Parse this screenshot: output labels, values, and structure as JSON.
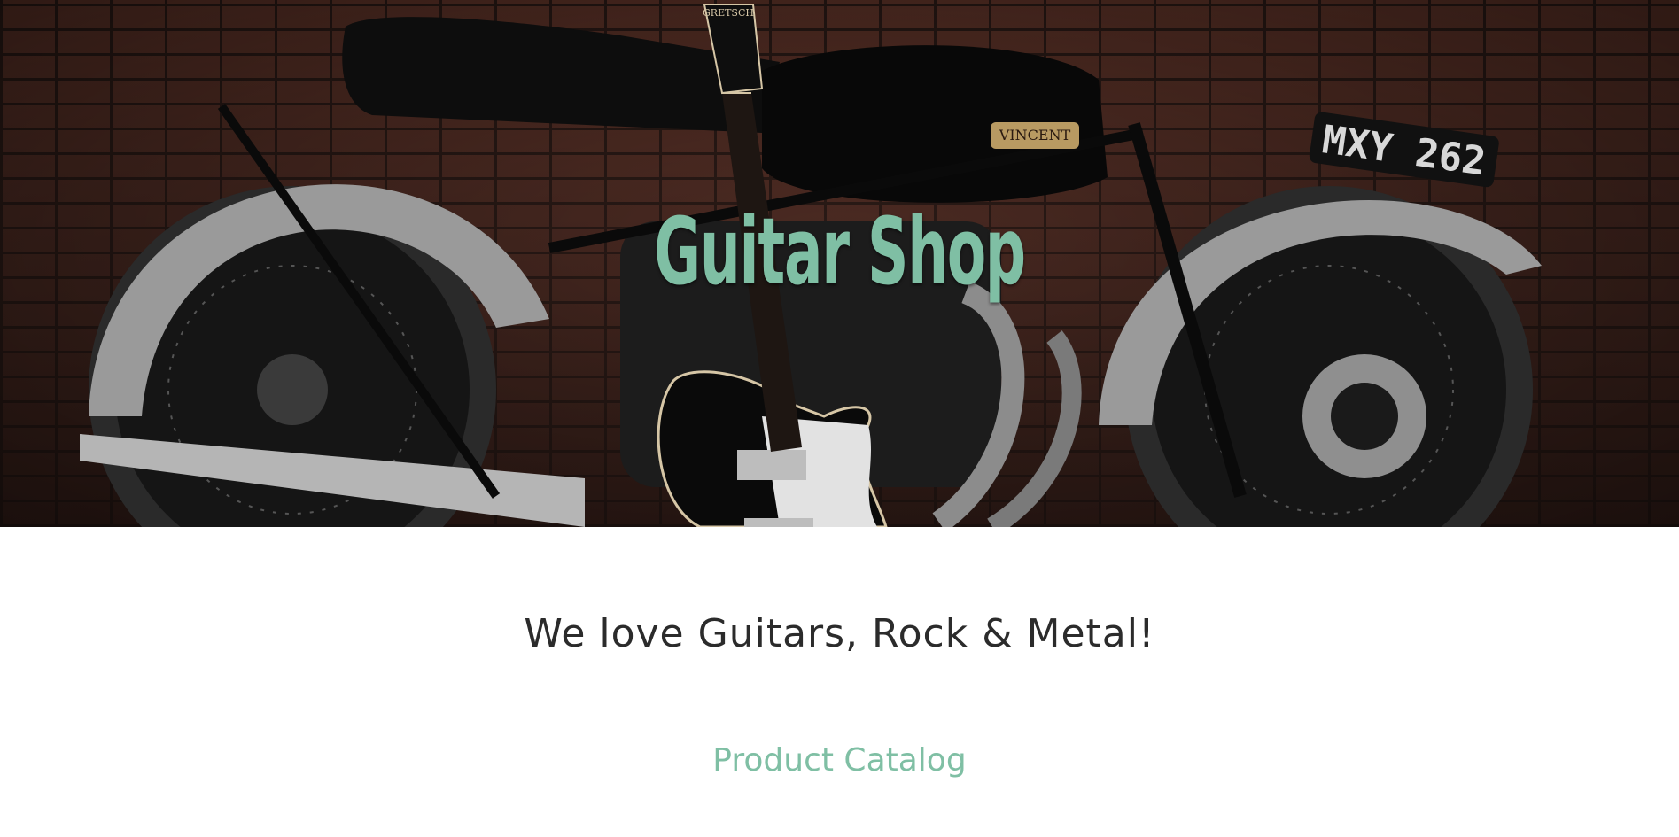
{
  "hero": {
    "title": "Guitar Shop",
    "plate_text": "MXY 262",
    "badge_text": "VINCENT",
    "headstock_text": "GRETSCH"
  },
  "main": {
    "tagline": "We love Guitars, Rock & Metal!",
    "catalog_link": "Product Catalog"
  },
  "colors": {
    "accent": "#7fbfa4",
    "text": "#2b2b2b",
    "background": "#ffffff"
  }
}
